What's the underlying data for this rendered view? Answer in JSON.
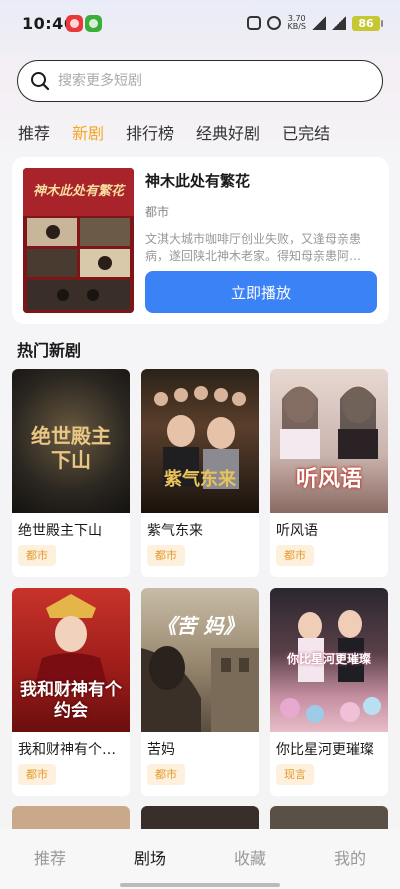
{
  "status_bar": {
    "time": "10:46",
    "speed_top": "3.70",
    "speed_bottom": "KB/S",
    "battery": "86"
  },
  "search": {
    "placeholder": "搜索更多短剧"
  },
  "tabs": [
    {
      "label": "推荐"
    },
    {
      "label": "新剧"
    },
    {
      "label": "排行榜"
    },
    {
      "label": "经典好剧"
    },
    {
      "label": "已完结"
    }
  ],
  "featured": {
    "title": "神木此处有繁花",
    "tag": "都市",
    "description": "文淇大城市咖啡厅创业失败，又逢母亲患病，遂回陕北神木老家。得知母亲患阿…",
    "play_label": "立即播放",
    "poster_text": "神木此处有繁花"
  },
  "section_title": "热门新剧",
  "dramas": [
    {
      "title": "绝世殿主下山",
      "tag": "都市",
      "poster_text": "绝世殿主下山"
    },
    {
      "title": "紫气东来",
      "tag": "都市",
      "poster_text": "紫气东来"
    },
    {
      "title": "听风语",
      "tag": "都市",
      "poster_text": "听风语"
    },
    {
      "title": "我和财神有个…",
      "tag": "都市",
      "poster_text": "我和财神有个约会"
    },
    {
      "title": "苦妈",
      "tag": "都市",
      "poster_text": "《苦 妈》"
    },
    {
      "title": "你比星河更璀璨",
      "tag": "现言",
      "poster_text": "你比星河更璀璨"
    }
  ],
  "bottom_nav": [
    {
      "label": "推荐"
    },
    {
      "label": "剧场"
    },
    {
      "label": "收藏"
    },
    {
      "label": "我的"
    }
  ],
  "colors": {
    "accent": "#f5a623",
    "play_button": "#3b82f6",
    "tag_bg": "#fdf0dc",
    "tag_text": "#e49a2a"
  }
}
